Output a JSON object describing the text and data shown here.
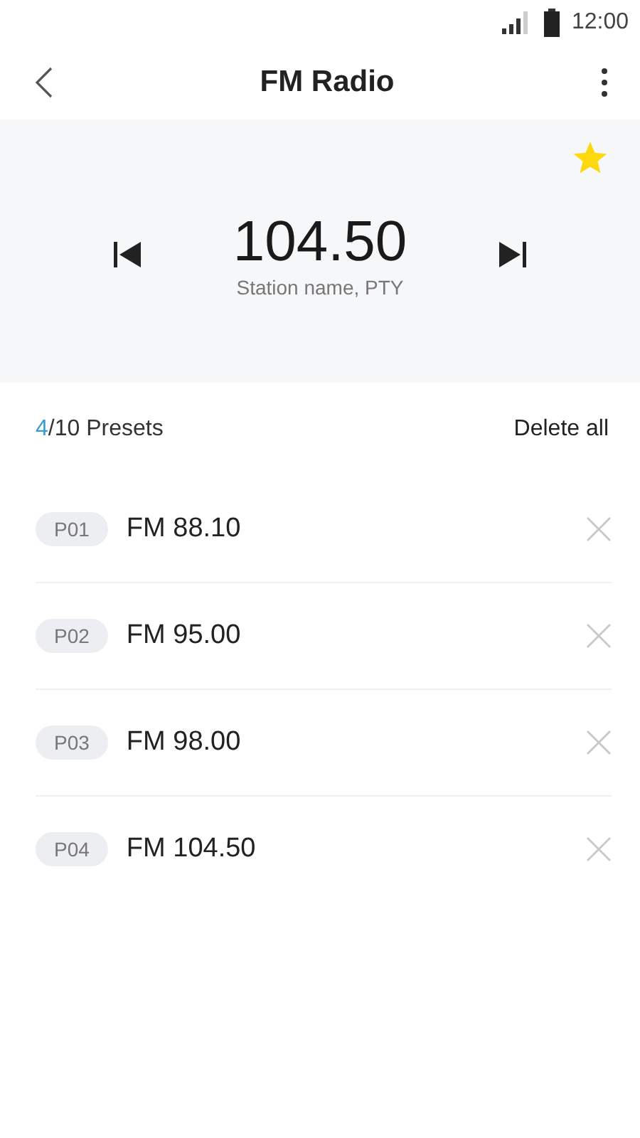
{
  "status_bar": {
    "time": "12:00"
  },
  "header": {
    "title": "FM Radio"
  },
  "tuner": {
    "frequency": "104.50",
    "station": "Station name, PTY",
    "favorite": true
  },
  "presets_header": {
    "count": "4",
    "label": "/10 Presets",
    "action": "Delete all"
  },
  "presets": [
    {
      "badge": "P01",
      "name": "FM 88.10"
    },
    {
      "badge": "P02",
      "name": "FM 95.00"
    },
    {
      "badge": "P03",
      "name": "FM 98.00"
    },
    {
      "badge": "P04",
      "name": "FM 104.50"
    }
  ]
}
